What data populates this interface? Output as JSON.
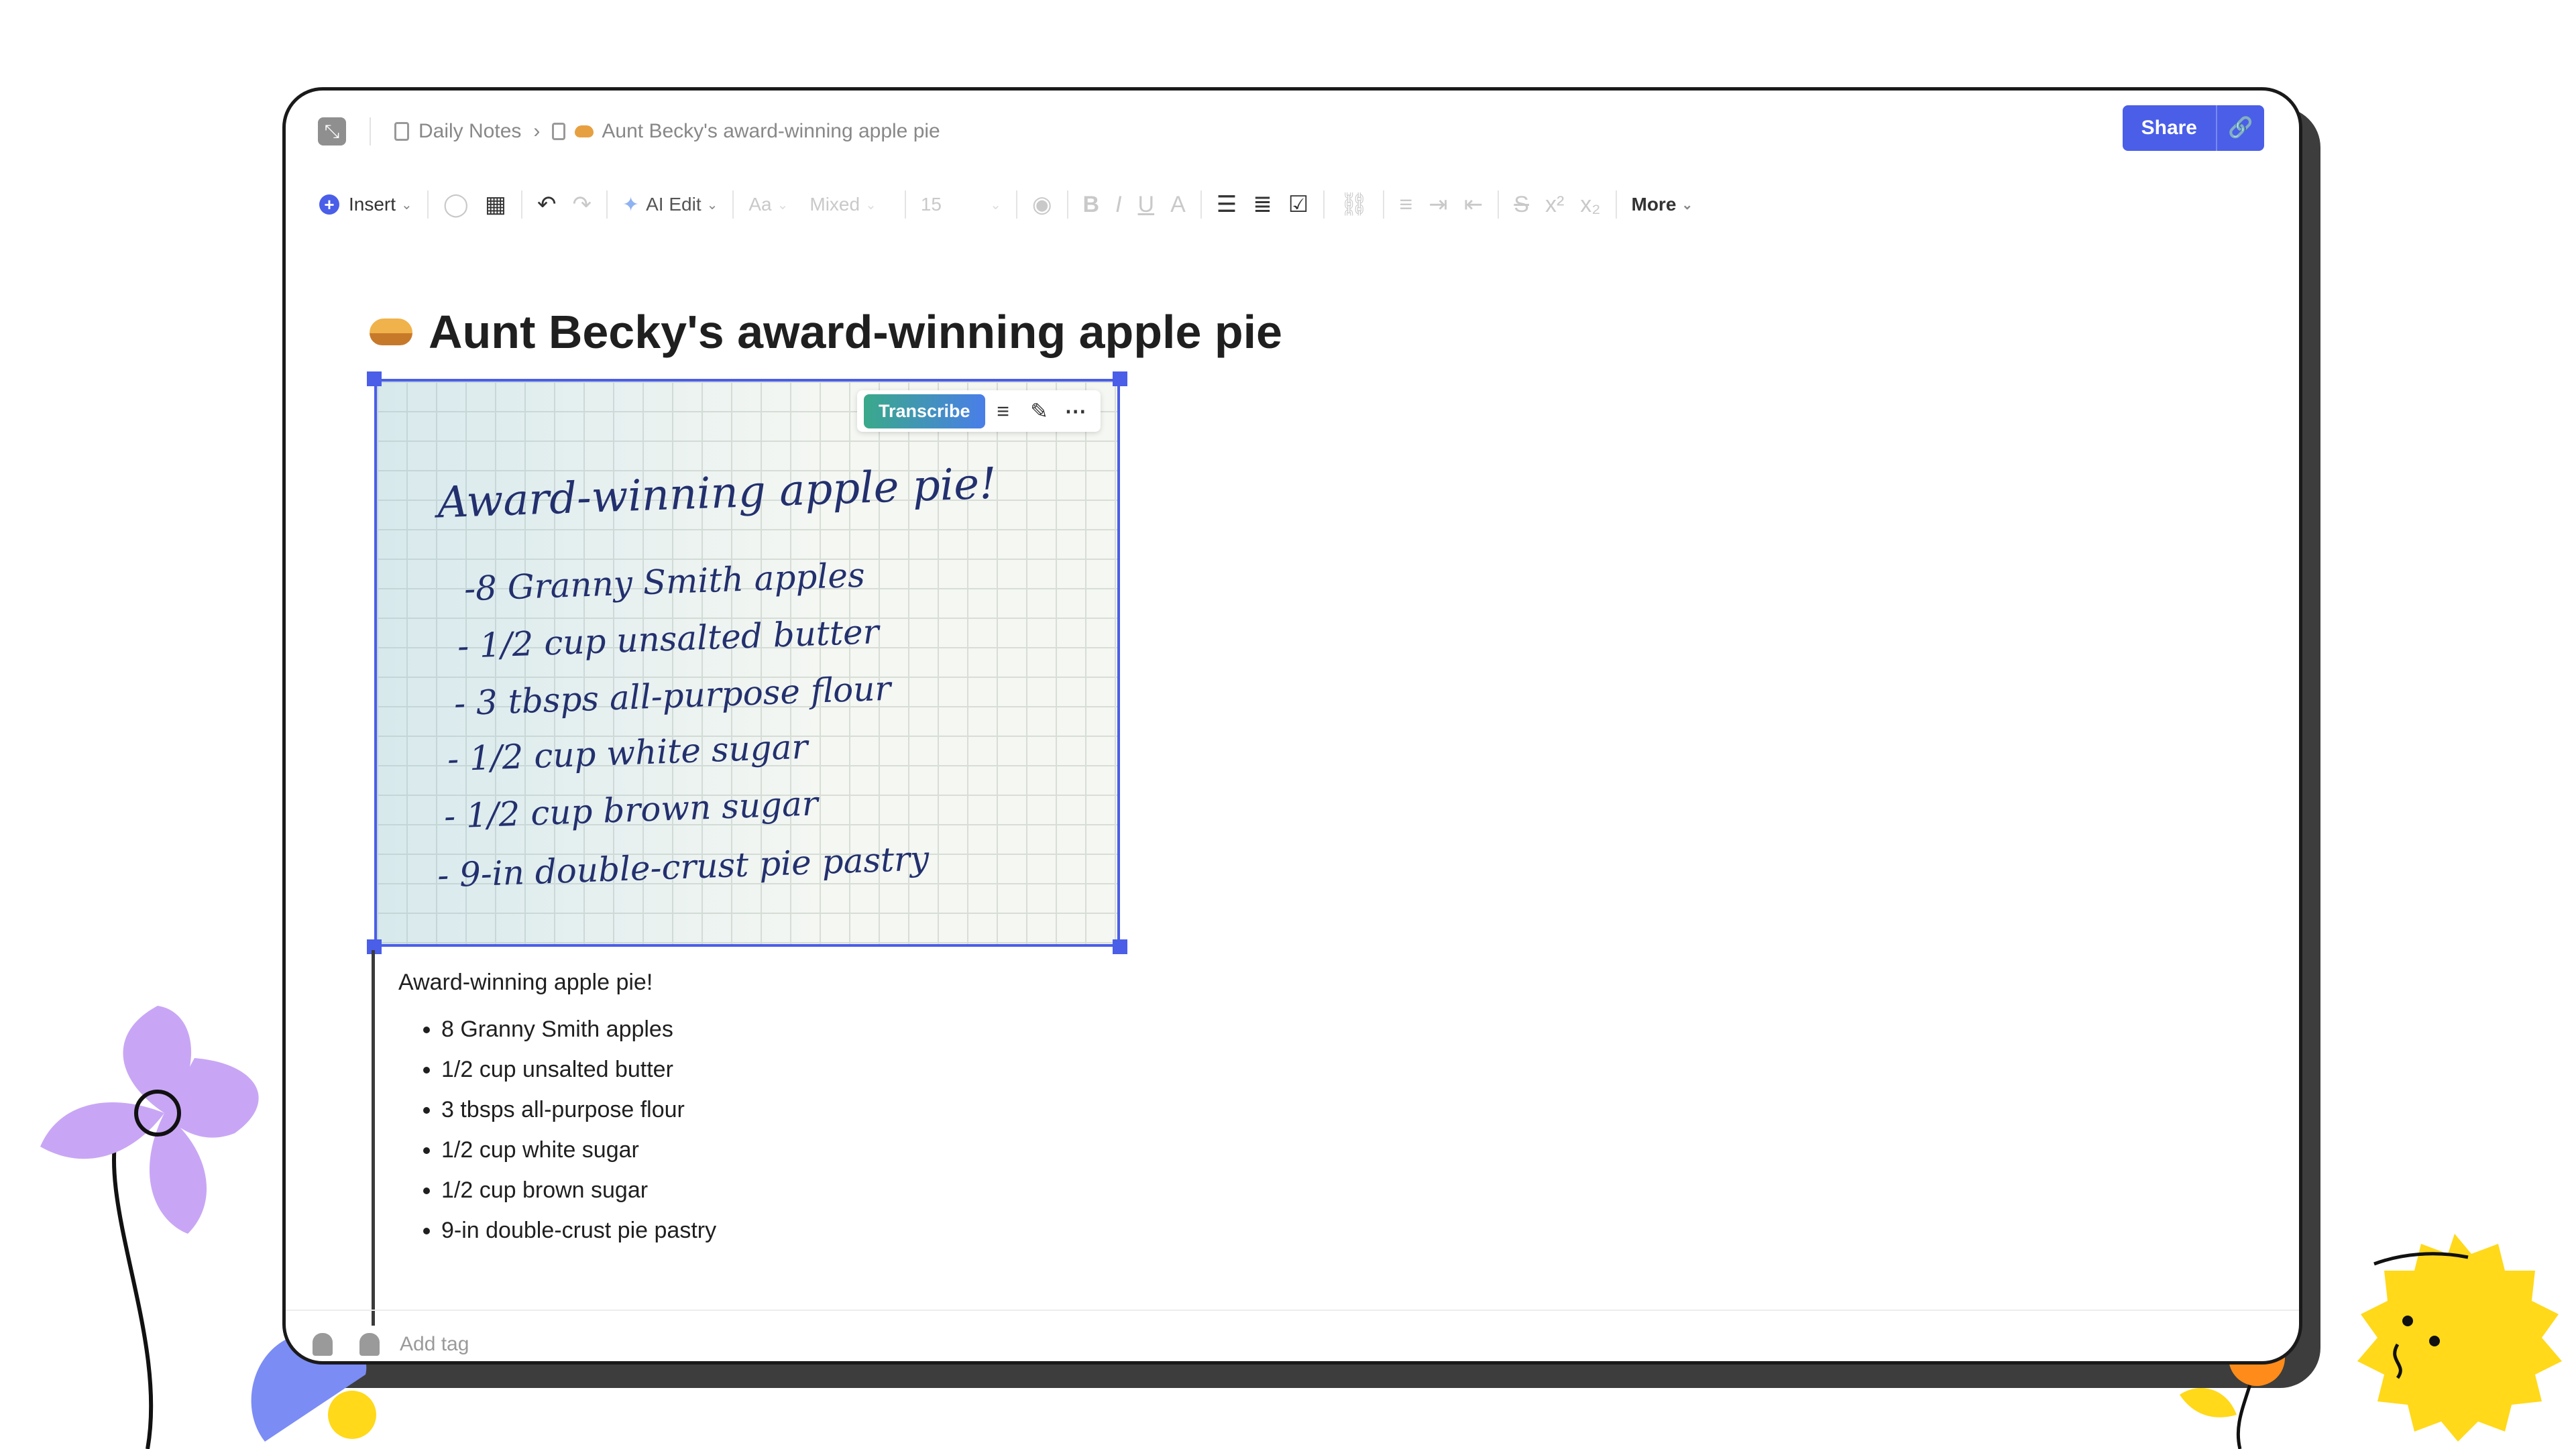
{
  "breadcrumb": {
    "parent": "Daily Notes",
    "separator": "›",
    "current": "Aunt Becky's award-winning apple pie"
  },
  "header": {
    "share_label": "Share",
    "link_icon": "link-icon"
  },
  "toolbar": {
    "insert": "Insert",
    "ai_edit": "AI Edit",
    "font_style": "Aa",
    "heading_style": "Mixed",
    "font_size": "15",
    "more": "More"
  },
  "page": {
    "title": "Aunt Becky's award-winning apple pie",
    "emoji": "pie"
  },
  "image_toolbar": {
    "transcribe": "Transcribe"
  },
  "handwriting": {
    "title": "Award-winning apple pie!",
    "lines": [
      "-8 Granny Smith apples",
      "- 1/2 cup unsalted butter",
      "- 3 tbsps all-purpose flour",
      "- 1/2 cup white sugar",
      "- 1/2 cup brown sugar",
      "- 9-in double-crust pie pastry"
    ]
  },
  "transcription": {
    "title": "Award-winning apple pie!",
    "items": [
      "8 Granny Smith apples",
      "1/2 cup unsalted butter",
      "3 tbsps all-purpose flour",
      "1/2 cup white sugar",
      "1/2 cup brown sugar",
      "9-in double-crust pie pastry"
    ]
  },
  "footer": {
    "add_tag": "Add tag"
  },
  "colors": {
    "accent": "#4a5ee8",
    "border": "#1a1a1a",
    "transcribe_from": "#3aa98a",
    "transcribe_to": "#4a7ee8"
  }
}
